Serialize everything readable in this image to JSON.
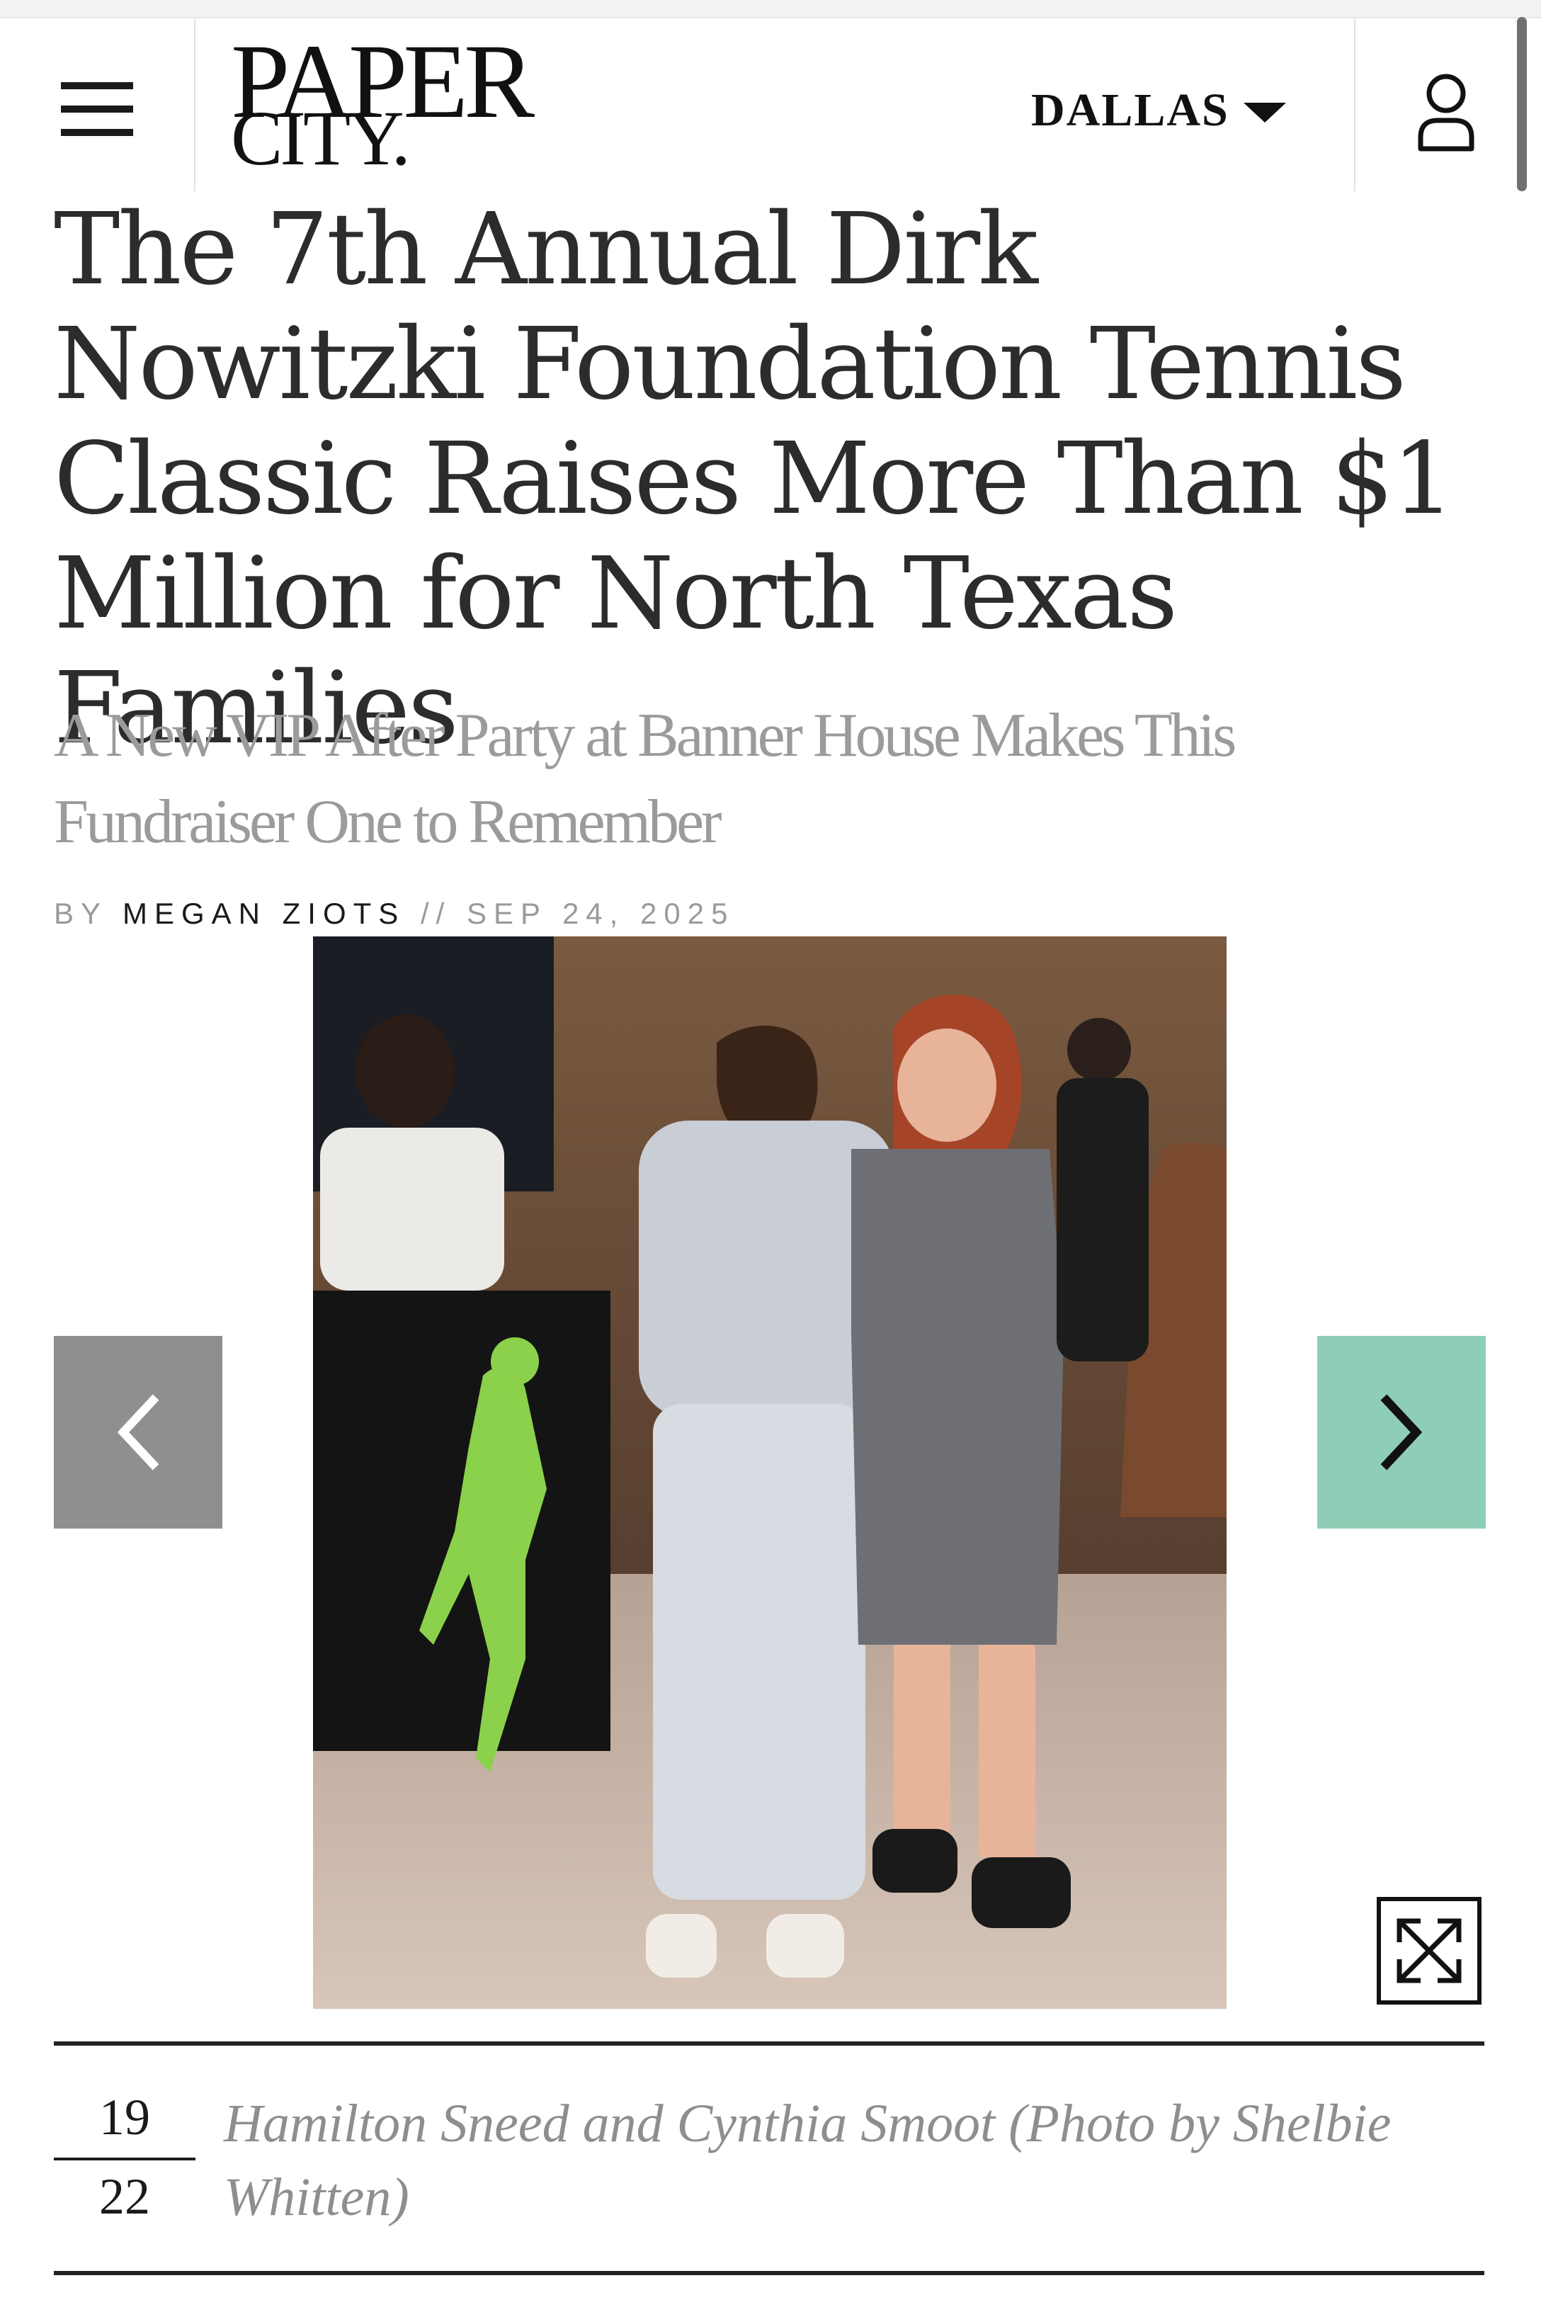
{
  "header": {
    "logo_line1": "PAPER",
    "logo_line2": "CITY.",
    "city": "DALLAS",
    "menu_icon": "hamburger-icon",
    "account_icon": "user-icon"
  },
  "article": {
    "title": "The 7th Annual Dirk Nowitzki Foundation Tennis Classic Raises More Than $1 Million for North Texas Families",
    "subtitle": "A New VIP After Party at Banner House Makes This Fundraiser One to Remember",
    "byline_prefix": "BY",
    "author": "MEGAN ZIOTS",
    "date_separator": "//",
    "date": "SEP 24, 2025"
  },
  "gallery": {
    "current": "19",
    "total": "22",
    "caption": "Hamilton Sneed and Cynthia Smoot (Photo by Shelbie Whitten)",
    "prev_icon": "chevron-left-icon",
    "next_icon": "chevron-right-icon",
    "expand_icon": "expand-icon",
    "colors": {
      "prev_bg": "#8f8f8f",
      "next_bg": "#8fceb6",
      "logo_green": "#8bd14b"
    }
  }
}
